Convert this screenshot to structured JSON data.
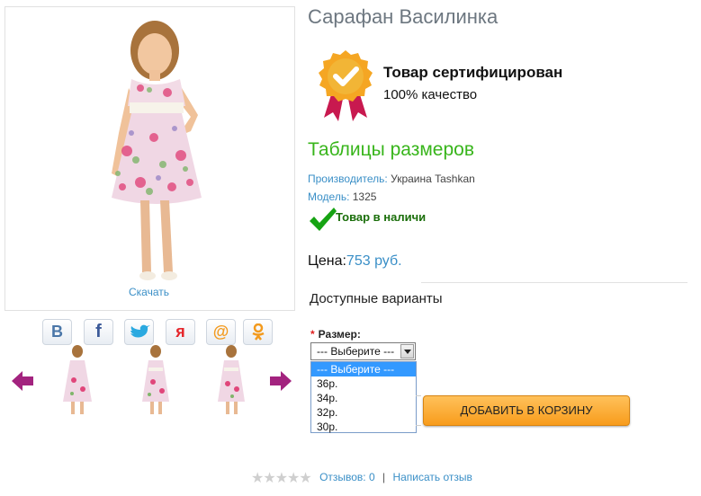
{
  "product": {
    "title": "Сарафан Василинка",
    "download_link": "Скачать"
  },
  "social_buttons": [
    {
      "name": "vk",
      "glyph": "В",
      "color": "#4a76a8"
    },
    {
      "name": "facebook",
      "glyph": "f",
      "color": "#3b5998"
    },
    {
      "name": "twitter",
      "glyph": "twitter-bird",
      "color": "#2aa9e0"
    },
    {
      "name": "moikrug",
      "glyph": "я",
      "color": "#e5262b"
    },
    {
      "name": "mailru",
      "glyph": "@",
      "color": "#f39a1d"
    },
    {
      "name": "odnoklassniki",
      "glyph": "ok",
      "color": "#f39a1d"
    }
  ],
  "certificate": {
    "title": "Товар сертифицирован",
    "subtitle": "100% качество"
  },
  "size_tables_link": "Таблицы размеров",
  "manufacturer": {
    "label": "Производитель:",
    "value": "Украина Tashkan"
  },
  "model": {
    "label": "Модель:",
    "value": "1325"
  },
  "stock": "Товар в наличи",
  "price": {
    "label": "Цена:",
    "value": "753 руб."
  },
  "variants_heading": "Доступные варианты",
  "size_option": {
    "required_mark": "*",
    "label": "Размер:",
    "selected": "--- Выберите ---",
    "options": [
      "--- Выберите ---",
      "36р.",
      "34р.",
      "32р.",
      "30р."
    ]
  },
  "add_to_cart": "ДОБАВИТЬ В КОРЗИНУ",
  "reviews": {
    "count_text": "Отзывов: 0",
    "separator": "|",
    "write_link": "Написать отзыв",
    "stars": "★★★★★",
    "rating": 0
  },
  "colors": {
    "link": "#3a8fc7",
    "green": "#38b51b",
    "button_orange": "#f89c1c"
  }
}
